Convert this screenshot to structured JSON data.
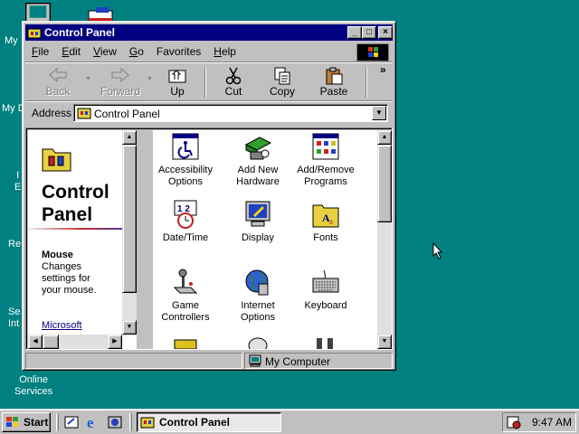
{
  "desktop": {
    "icons": [
      {
        "label": "My",
        "name": "my-computer"
      },
      {
        "label": "My D",
        "name": "my-documents"
      },
      {
        "label": "I\nE",
        "name": "internet-explorer"
      },
      {
        "label": "Re",
        "name": "recycle-bin"
      },
      {
        "label": "Se\nInt",
        "name": "setup-internet"
      },
      {
        "label": "Online\nServices",
        "name": "online-services"
      }
    ]
  },
  "window": {
    "title": "Control Panel",
    "buttons": {
      "minimize": "_",
      "maximize": "□",
      "close": "×"
    },
    "menu": [
      {
        "label": "File",
        "u": "F",
        "rest": "ile"
      },
      {
        "label": "Edit",
        "u": "E",
        "rest": "dit"
      },
      {
        "label": "View",
        "u": "V",
        "rest": "iew"
      },
      {
        "label": "Go",
        "u": "G",
        "rest": "o"
      },
      {
        "label": "Favorites",
        "u": "F",
        "pre": "",
        "rest": "avorites",
        "full": "Favorites"
      },
      {
        "label": "Help",
        "u": "H",
        "rest": "elp"
      }
    ],
    "toolbar": {
      "back": "Back",
      "forward": "Forward",
      "up": "Up",
      "cut": "Cut",
      "copy": "Copy",
      "paste": "Paste",
      "more": "»"
    },
    "address": {
      "label": "Address",
      "value": "Control Panel"
    },
    "left_pane": {
      "title_line1": "Control",
      "title_line2": "Panel",
      "selected_name": "Mouse",
      "desc_line1": "Changes",
      "desc_line2": "settings for",
      "desc_line3": "your mouse.",
      "link": "Microsoft"
    },
    "items": [
      {
        "line1": "Accessibility",
        "line2": "Options",
        "icon": "accessibility-icon"
      },
      {
        "line1": "Add New",
        "line2": "Hardware",
        "icon": "hardware-icon"
      },
      {
        "line1": "Add/Remove",
        "line2": "Programs",
        "icon": "add-remove-icon"
      },
      {
        "line1": "Date/Time",
        "line2": "",
        "icon": "clock-icon"
      },
      {
        "line1": "Display",
        "line2": "",
        "icon": "display-icon"
      },
      {
        "line1": "Fonts",
        "line2": "",
        "icon": "fonts-icon"
      },
      {
        "line1": "Game",
        "line2": "Controllers",
        "icon": "joystick-icon"
      },
      {
        "line1": "Internet",
        "line2": "Options",
        "icon": "globe-icon"
      },
      {
        "line1": "Keyboard",
        "line2": "",
        "icon": "keyboard-icon"
      }
    ],
    "status": {
      "zone": "My Computer"
    }
  },
  "taskbar": {
    "start": "Start",
    "task": "Control Panel",
    "clock": "9:47 AM"
  }
}
